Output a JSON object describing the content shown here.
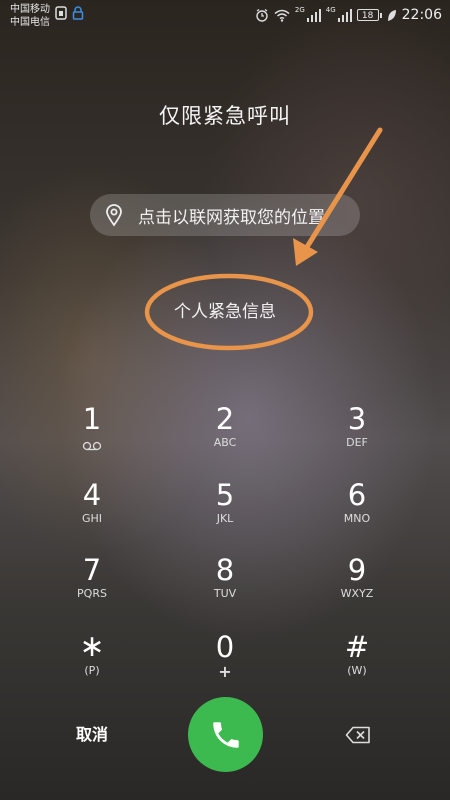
{
  "status_bar": {
    "carrier_1": "中国移动",
    "carrier_2": "中国电信",
    "net_label_1": "2G",
    "net_label_2": "4G",
    "battery": "18",
    "time": "22:06"
  },
  "title": "仅限紧急呼叫",
  "location": {
    "label": "点击以联网获取您的位置",
    "icon": "location-pin-icon"
  },
  "emergency_info": "个人紧急信息",
  "annotation_colors": {
    "arrow": "#e8944a",
    "ellipse": "#e8944a"
  },
  "keypad": [
    {
      "num": "1",
      "sub": ""
    },
    {
      "num": "2",
      "sub": "ABC"
    },
    {
      "num": "3",
      "sub": "DEF"
    },
    {
      "num": "4",
      "sub": "GHI"
    },
    {
      "num": "5",
      "sub": "JKL"
    },
    {
      "num": "6",
      "sub": "MNO"
    },
    {
      "num": "7",
      "sub": "PQRS"
    },
    {
      "num": "8",
      "sub": "TUV"
    },
    {
      "num": "9",
      "sub": "WXYZ"
    },
    {
      "num": "∗",
      "sub": "(P)"
    },
    {
      "num": "0",
      "sub": "+"
    },
    {
      "num": "#",
      "sub": "(W)"
    }
  ],
  "actions": {
    "cancel": "取消",
    "call_color": "#3cba4f",
    "call_icon": "phone-icon",
    "backspace_icon": "backspace-icon"
  }
}
